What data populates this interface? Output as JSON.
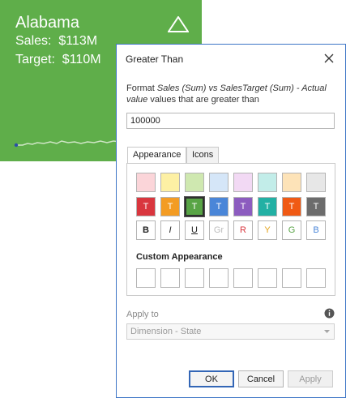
{
  "card": {
    "title": "Alabama",
    "sales_line": "Sales:  $113M",
    "target_line": "Target:  $110M",
    "trend_icon": "triangle-up-icon",
    "bg_color": "#5fae4a"
  },
  "dialog": {
    "title": "Greater Than",
    "close_icon": "close-icon",
    "description": {
      "prefix": "Format ",
      "measure": "Sales (Sum) vs SalesTarget (Sum) - Actual value",
      "suffix": " values that are greater than"
    },
    "value": "100000",
    "tabs": [
      {
        "label": "Appearance",
        "active": true
      },
      {
        "label": "Icons",
        "active": false
      }
    ],
    "light_swatches": [
      "#fbd5d9",
      "#fdf0a4",
      "#cfe8b0",
      "#d5e6f8",
      "#f2d9f4",
      "#c2ede9",
      "#fde3b8",
      "#e7e7e7"
    ],
    "dark_swatches": [
      {
        "color": "#d9363e",
        "label": "T"
      },
      {
        "color": "#f39c24",
        "label": "T"
      },
      {
        "color": "#58a445",
        "label": "T"
      },
      {
        "color": "#4a86d8",
        "label": "T"
      },
      {
        "color": "#8c5cbf",
        "label": "T"
      },
      {
        "color": "#22b0a4",
        "label": "T"
      },
      {
        "color": "#f05a14",
        "label": "T"
      },
      {
        "color": "#6c6c6c",
        "label": "T"
      }
    ],
    "selected_dark_index": 2,
    "font_styles": [
      {
        "label": "B",
        "color": "#222222",
        "style": "bold"
      },
      {
        "label": "I",
        "color": "#222222",
        "style": "italic"
      },
      {
        "label": "U",
        "color": "#222222",
        "style": "underline"
      },
      {
        "label": "Gr",
        "color": "#bdbdbd",
        "style": "normal"
      },
      {
        "label": "R",
        "color": "#d9363e",
        "style": "normal"
      },
      {
        "label": "Y",
        "color": "#e3a21a",
        "style": "normal"
      },
      {
        "label": "G",
        "color": "#58a445",
        "style": "normal"
      },
      {
        "label": "B",
        "color": "#4a86d8",
        "style": "normal"
      }
    ],
    "custom_heading": "Custom Appearance",
    "custom_cells": 8,
    "apply_to_label": "Apply to",
    "apply_to_value": "Dimension - State",
    "info_icon": "info-icon",
    "buttons": {
      "ok": "OK",
      "cancel": "Cancel",
      "apply": "Apply"
    }
  }
}
